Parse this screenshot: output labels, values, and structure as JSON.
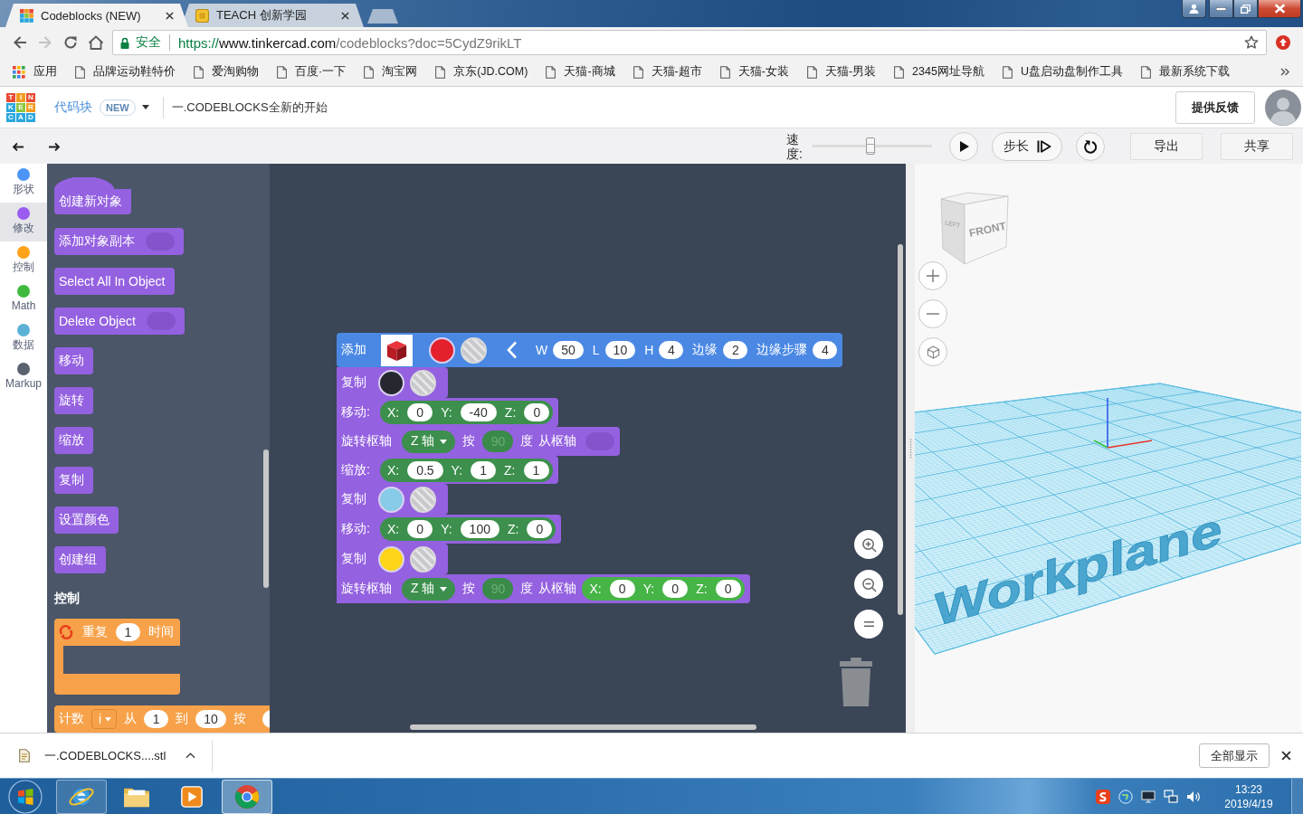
{
  "browser": {
    "tabs": [
      {
        "title": "Codeblocks (NEW)",
        "kind": "tinkercad",
        "selected": true
      },
      {
        "title": "TEACH 创新学园",
        "kind": "teach",
        "selected": false
      }
    ],
    "forward_disabled": true,
    "address_bar": {
      "security_label": "安全",
      "url_scheme": "https://",
      "url_host": "www.tinkercad.com",
      "url_path": "/codeblocks?doc=5CydZ9rikLT"
    },
    "bookmarks": [
      {
        "kind": "apps",
        "label": "应用"
      },
      {
        "kind": "page",
        "label": "品牌运动鞋特价"
      },
      {
        "kind": "page",
        "label": "爱淘购物"
      },
      {
        "kind": "page",
        "label": "百度·一下"
      },
      {
        "kind": "page",
        "label": "淘宝网"
      },
      {
        "kind": "page",
        "label": "京东(JD.COM)"
      },
      {
        "kind": "page",
        "label": "天猫-商城"
      },
      {
        "kind": "page",
        "label": "天猫-超市"
      },
      {
        "kind": "page",
        "label": "天猫-女装"
      },
      {
        "kind": "page",
        "label": "天猫-男装"
      },
      {
        "kind": "page",
        "label": "2345网址导航"
      },
      {
        "kind": "page",
        "label": "U盘启动盘制作工具"
      },
      {
        "kind": "page",
        "label": "最新系统下载"
      }
    ]
  },
  "app_header": {
    "logo_letters": [
      "T",
      "I",
      "N",
      "K",
      "E",
      "R",
      "C",
      "A",
      "D"
    ],
    "product": "代码块",
    "badge": "NEW",
    "design_title": "一.CODEBLOCKS全新的开始",
    "feedback_button": "提供反馈"
  },
  "toolbar": {
    "speed_label": "速度:",
    "speed": {
      "level": 0.49
    },
    "step_button": "步长",
    "export_button": "导出",
    "share_button": "共享"
  },
  "categories": [
    {
      "label": "形状",
      "color": "#4c94f5",
      "selected": false
    },
    {
      "label": "修改",
      "color": "#9a5cf0",
      "selected": true
    },
    {
      "label": "控制",
      "color": "#ffa31a",
      "selected": false
    },
    {
      "label": "Math",
      "color": "#3fba3f",
      "selected": false
    },
    {
      "label": "数据",
      "color": "#5cb1d6",
      "selected": false
    },
    {
      "label": "Markup",
      "color": "#5a6270",
      "selected": false
    }
  ],
  "palette": {
    "items": [
      {
        "kind": "hat",
        "label": "创建新对象"
      },
      {
        "kind": "toggle",
        "label": "添加对象副本"
      },
      {
        "kind": "plain",
        "label": "Select All In Object"
      },
      {
        "kind": "toggle",
        "label": "Delete Object"
      },
      {
        "kind": "plain",
        "label": "移动"
      },
      {
        "kind": "plain",
        "label": "旋转"
      },
      {
        "kind": "plain",
        "label": "缩放"
      },
      {
        "kind": "plain",
        "label": "复制"
      },
      {
        "kind": "plain",
        "label": "设置颜色"
      },
      {
        "kind": "plain",
        "label": "创建组"
      },
      {
        "kind": "heading",
        "label": "控制"
      },
      {
        "kind": "repeat",
        "label": "重复",
        "value": "1",
        "unit": "时间"
      },
      {
        "kind": "count",
        "label": "计数",
        "variable": "i",
        "from_label": "从",
        "from": "1",
        "to_label": "到",
        "to": "10",
        "step_label": "按"
      }
    ]
  },
  "workspace": {
    "blocks": [
      {
        "kind": "add",
        "label": "添加",
        "color": "#e3202c",
        "fields": [
          {
            "label": "W",
            "value": "50"
          },
          {
            "label": "L",
            "value": "10"
          },
          {
            "label": "H",
            "value": "4"
          },
          {
            "label": "边缘",
            "value": "2"
          },
          {
            "label": "边缘步骤",
            "value": "4"
          }
        ]
      },
      {
        "kind": "copy",
        "label": "复制",
        "color": "#25282e"
      },
      {
        "kind": "move",
        "label": "移动:",
        "fields": [
          {
            "label": "X:",
            "value": "0"
          },
          {
            "label": "Y:",
            "value": "-40"
          },
          {
            "label": "Z:",
            "value": "0"
          }
        ]
      },
      {
        "kind": "rotate",
        "label": "旋转枢轴",
        "axis": "Z 轴",
        "by_label": "按",
        "angle": "90",
        "unit": "度",
        "pivot_label": "从枢轴"
      },
      {
        "kind": "scale",
        "label": "缩放:",
        "fields": [
          {
            "label": "X:",
            "value": "0.5"
          },
          {
            "label": "Y:",
            "value": "1"
          },
          {
            "label": "Z:",
            "value": "1"
          }
        ]
      },
      {
        "kind": "copy",
        "label": "复制",
        "color": "#87cbe8"
      },
      {
        "kind": "move",
        "label": "移动:",
        "fields": [
          {
            "label": "X:",
            "value": "0"
          },
          {
            "label": "Y:",
            "value": "100"
          },
          {
            "label": "Z:",
            "value": "0"
          }
        ]
      },
      {
        "kind": "copy",
        "label": "复制",
        "color": "#ffd519"
      },
      {
        "kind": "rotate",
        "label": "旋转枢轴",
        "axis": "Z 轴",
        "by_label": "按",
        "angle": "90",
        "unit": "度",
        "pivot_label": "从枢轴",
        "pivot": [
          {
            "label": "X:",
            "value": "0"
          },
          {
            "label": "Y:",
            "value": "0"
          },
          {
            "label": "Z:",
            "value": "0"
          }
        ]
      }
    ]
  },
  "view_3d": {
    "cube_front": "FRONT",
    "cube_left": "LEFT",
    "workplane_label": "Workplane"
  },
  "download_bar": {
    "file_name": "一.CODEBLOCKS....stl",
    "show_all_button": "全部显示"
  },
  "taskbar": {
    "apps": [
      {
        "kind": "ie",
        "running": true,
        "selected": false
      },
      {
        "kind": "explorer",
        "running": false,
        "selected": false
      },
      {
        "kind": "media",
        "running": false,
        "selected": false
      },
      {
        "kind": "chrome",
        "running": true,
        "selected": true
      }
    ],
    "time": "13:23",
    "date": "2019/4/19"
  }
}
